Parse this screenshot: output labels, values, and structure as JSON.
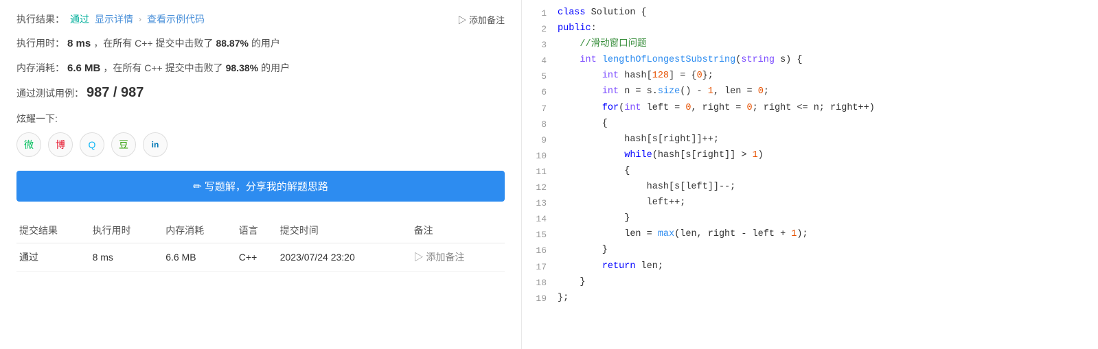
{
  "left": {
    "result_label": "执行结果：",
    "result_pass": "通过",
    "show_details": "显示详情",
    "arrow": "›",
    "view_example": "查看示例代码",
    "add_note": "▷ 添加备注",
    "exec_time_label": "执行用时：",
    "exec_time_value": "8 ms",
    "exec_time_suffix": "，在所有 C++ 提交中击败了",
    "exec_time_percent": "88.87%",
    "exec_time_users": "的用户",
    "mem_label": "内存消耗：",
    "mem_value": "6.6 MB",
    "mem_suffix": "，在所有 C++ 提交中击败了",
    "mem_percent": "98.38%",
    "mem_users": "的用户",
    "testcase_label": "通过测试用例：",
    "testcase_value": "987 / 987",
    "brag_label": "炫耀一下:",
    "write_btn": "✏ 写题解，分享我的解题思路",
    "table": {
      "headers": [
        "提交结果",
        "执行用时",
        "内存消耗",
        "语言",
        "提交时间",
        "备注"
      ],
      "rows": [
        {
          "result": "通过",
          "time": "8 ms",
          "memory": "6.6 MB",
          "lang": "C++",
          "submit_time": "2023/07/24 23:20",
          "note": "▷ 添加备注"
        }
      ]
    }
  },
  "code": {
    "lines": [
      {
        "num": "1",
        "content": "class Solution {"
      },
      {
        "num": "2",
        "content": "public:"
      },
      {
        "num": "3",
        "content": "    //滑动窗口问题"
      },
      {
        "num": "4",
        "content": "    int lengthOfLongestSubstring(string s) {"
      },
      {
        "num": "5",
        "content": "        int hash[128] = {0};"
      },
      {
        "num": "6",
        "content": "        int n = s.size() - 1, len = 0;"
      },
      {
        "num": "7",
        "content": "        for(int left = 0, right = 0; right <= n; right++)"
      },
      {
        "num": "8",
        "content": "        {"
      },
      {
        "num": "9",
        "content": "            hash[s[right]]++;"
      },
      {
        "num": "10",
        "content": "            while(hash[s[right]] > 1)"
      },
      {
        "num": "11",
        "content": "            {"
      },
      {
        "num": "12",
        "content": "                hash[s[left]]--;"
      },
      {
        "num": "13",
        "content": "                left++;"
      },
      {
        "num": "14",
        "content": "            }"
      },
      {
        "num": "15",
        "content": "            len = max(len, right - left + 1);"
      },
      {
        "num": "16",
        "content": "        }"
      },
      {
        "num": "17",
        "content": "        return len;"
      },
      {
        "num": "18",
        "content": "    }"
      },
      {
        "num": "19",
        "content": "};"
      }
    ]
  },
  "icons": {
    "wechat": "微",
    "weibo": "博",
    "qq": "Q",
    "douban": "豆",
    "linkedin": "in"
  }
}
